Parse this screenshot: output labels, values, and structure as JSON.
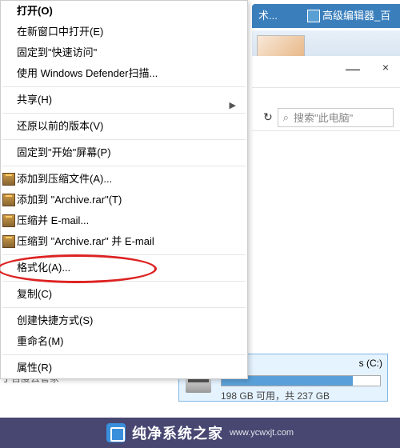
{
  "tabs": {
    "tab1_suffix": "术...",
    "tab2": "高级编辑器_百度"
  },
  "win": {
    "minimize": "—",
    "close": "×"
  },
  "toolbar": {
    "refresh": "↻",
    "search_placeholder": "搜索\"此电脑\"",
    "search_icon": "⌕"
  },
  "menu": {
    "open": "打开(O)",
    "open_new": "在新窗口中打开(E)",
    "pin_quick": "固定到\"快速访问\"",
    "defender": "使用 Windows Defender扫描...",
    "share": "共享(H)",
    "restore": "还原以前的版本(V)",
    "pin_start": "固定到\"开始\"屏幕(P)",
    "rar_add": "添加到压缩文件(A)...",
    "rar_addto": "添加到 \"Archive.rar\"(T)",
    "rar_email": "压缩并 E-mail...",
    "rar_addemail": "压缩到 \"Archive.rar\" 并 E-mail",
    "format": "格式化(A)...",
    "copy": "复制(C)",
    "shortcut": "创建快捷方式(S)",
    "rename": "重命名(M)",
    "props": "属性(R)"
  },
  "drive": {
    "label": "s (C:)",
    "text": "198 GB 可用，共 237 GB"
  },
  "bottom_text": "丁百度云管冢",
  "watermark": {
    "main": "纯净系统之家",
    "sub": "www.ycwxjt.com"
  }
}
